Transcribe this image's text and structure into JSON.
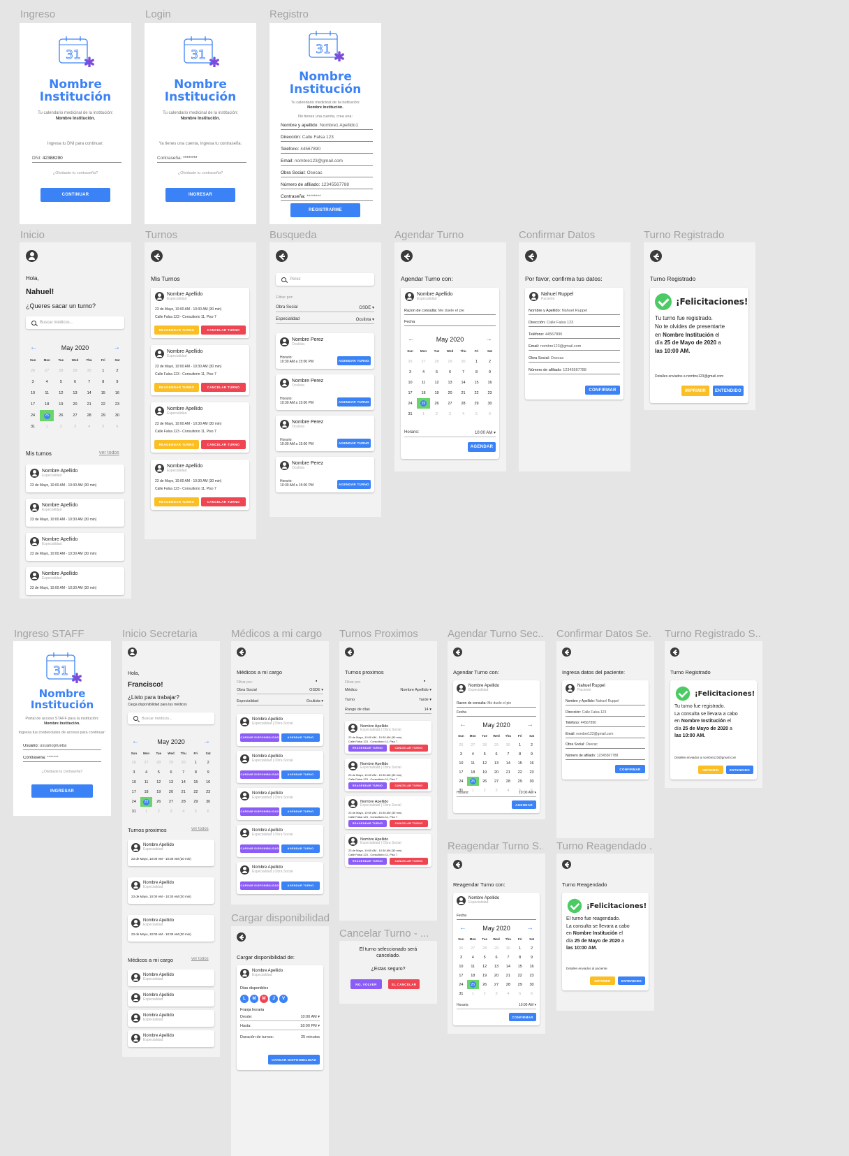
{
  "colors": {
    "accent": "#3b82f6",
    "warning": "#fbbf24",
    "danger": "#ef4452",
    "success": "#4ccb64",
    "purple": "#8b5cf6"
  },
  "logo": {
    "day": "31",
    "inst1": "Nombre",
    "inst2": "Institución"
  },
  "frames": {
    "ingreso": "Ingreso",
    "login": "Login",
    "registro": "Registro",
    "inicio": "Inicio",
    "turnos": "Turnos",
    "busqueda": "Busqueda",
    "agendar": "Agendar Turno",
    "confirmar": "Confirmar Datos",
    "registrado": "Turno Registrado",
    "staff": "Ingreso STAFF",
    "secretaria": "Inicio Secretaria",
    "medicos": "Médicos a mi cargo",
    "proximos": "Turnos Proximos",
    "agendarSec": "Agendar Turno Sec...",
    "confirmarSe": "Confirmar Datos Se...",
    "registradoS": "Turno Registrado S...",
    "cargar": "Cargar disponibilidad",
    "cancelar": "Cancelar Turno - ...",
    "reagendar": "Reagendar Turno S...",
    "reagendado": "Turno Reagendado ..."
  },
  "common": {
    "tag1": "Tu calendario medicinal de la institución:",
    "tagInst": "Nombre Institución.",
    "forgot": "¿Olvidaste tu contraseña?",
    "name": "Nombre Apellido",
    "spec": "Especialidad",
    "specObra": "Especialidad | Obra Social",
    "slot": "23 de Mayo, 10:00 AM - 10:30 AM (30 min)",
    "addr": "Calle Falsa 123 - Consultorio 11, Piso 7",
    "btnCambiar": "Cargar disponibilidad",
    "btnCancelar": "Cancelar turno",
    "btnReagendar": "Reagendar turno",
    "btnAgendar": "Agendar turno",
    "month": "May 2020",
    "seeAll": "ver todos"
  },
  "ingreso": {
    "prompt": "Ingresa tu DNI para continuar:",
    "dniLabel": "DNI:",
    "dni": "42388290",
    "btn": "Continuar"
  },
  "login": {
    "prompt": "Ya tienes una cuenta, ingresa tu contraseña:",
    "passLabel": "Contraseña:",
    "pass": "********",
    "btn": "Ingresar"
  },
  "registro": {
    "prompt": "No tienes una cuenta, crea una:",
    "btn": "Registrarme",
    "fields": [
      [
        "Nombre y apellido:",
        "Nombre1 Apellido1"
      ],
      [
        "Dirección:",
        "Calle Falsa 123"
      ],
      [
        "Teléfono:",
        "44567890"
      ],
      [
        "Email:",
        "nombre123@gmail.com"
      ],
      [
        "Obra Social:",
        "Osecac"
      ],
      [
        "Número de afiliado:",
        "12345567788"
      ],
      [
        "Contraseña:",
        "********"
      ]
    ]
  },
  "inicio": {
    "hola": "Hola,",
    "nombre": "Nahuel!",
    "pregunta": "¿Queres sacar un turno?",
    "search": "Buscar médicos...",
    "mis": "Mis turnos"
  },
  "turnos": {
    "title": "Mis Turnos"
  },
  "busqueda": {
    "search": "Perez",
    "filtrar": "Filtrar por:",
    "obra": "Obra Social",
    "obraVal": "OSDE",
    "esp": "Especialidad",
    "espVal": "Oculista",
    "doc": "Nombre Perez",
    "docSpec": "Oculista",
    "horario": "Horario:",
    "horas": "10:30 AM a 15:00 PM"
  },
  "agendar": {
    "title": "Agendar Turno con:",
    "razonLabel": "Razon de consulta:",
    "razon": "Me duele el pie",
    "fecha": "Fecha",
    "horario": "Horario:",
    "hora": "10:00 AM",
    "btn": "Agendar"
  },
  "confirmar": {
    "title": "Por favor, confirma tus datos:",
    "nombre": "Nahuel Ruppel",
    "rol": "Paciente",
    "btn": "Confirmar",
    "fields": [
      [
        "Nombre y Apellido:",
        "Nahuel Ruppel"
      ],
      [
        "Dirección:",
        "Calle Falsa 123"
      ],
      [
        "Teléfono:",
        "44567890"
      ],
      [
        "Email:",
        "nombre123@gmail.com"
      ],
      [
        "Obra Social:",
        "Osecac"
      ],
      [
        "Número de afiliado:",
        "12345567788"
      ]
    ]
  },
  "registrado": {
    "title": "Turno Registrado",
    "felic": "¡Felicitaciones!",
    "l1": "Tu turno fue registrado.",
    "l2": "No te olvides de presentarte",
    "l3a": "en ",
    "l3b": "Nombre Institución",
    "l3c": " el",
    "l4a": "día ",
    "l4b": "25 de Mayo de 2020",
    "l4c": " a",
    "l5": "las 10:00 AM.",
    "det": "Detalles enviados a nombre123@gmail.com",
    "b1": "Imprimir",
    "b2": "Entendido"
  },
  "staff": {
    "tag": "Portal de acceso STAFF para la institución:",
    "prompt": "Ingresa tus credenciales de acceso para continuar:",
    "userLabel": "Usuario:",
    "user": "usuarioprueba",
    "passLabel": "Contraseña:",
    "pass": "*******",
    "btn": "Ingresar"
  },
  "secretaria": {
    "hola": "Hola,",
    "nombre": "Francisco!",
    "pregunta": "¿Listo para trabajar?",
    "sub": "Carga disponibilidad para tus médicos",
    "search": "Buscar médicos...",
    "prox": "Turnos proximos",
    "med": "Médicos a mi cargo"
  },
  "medicos": {
    "title": "Médicos a mi cargo",
    "filtrar": "Filtrar por:",
    "obra": "Obra Social",
    "obraVal": "OSDE",
    "esp": "Especialidad",
    "espVal": "Oculista"
  },
  "proximos": {
    "title": "Turnos proximos",
    "filtrar": "Filtrar por:",
    "medico": "Médico",
    "medicoVal": "Nombre Apellido",
    "turno": "Turno",
    "turnoVal": "Tarde",
    "rango": "Rango de días",
    "rangoVal": "14"
  },
  "regSec": {
    "line1": "La consulta se llevara a cabo",
    "det": "Detalles enviados a nombre123@gmail.com"
  },
  "confSec": {
    "title": "Ingresa datos del paciente:"
  },
  "cargar": {
    "title": "Cargar disponibilidad de:",
    "dias": "Días disponibles",
    "days": [
      "L",
      "M",
      "M",
      "J",
      "V"
    ],
    "franja": "Franja horaria",
    "desde": "Desde:",
    "desdeVal": "10:00 AM",
    "hasta": "Hasta:",
    "hastaVal": "18:00 PM",
    "dur": "Duración de turnos:",
    "durVal": "25 minutos",
    "btn": "Cargar disponibilidad"
  },
  "cancelar": {
    "msg1": "El turno seleccionado será",
    "msg2": "cancelado.",
    "q": "¿Estas seguro?",
    "no": "No, volver",
    "si": "Si, cancelar"
  },
  "reagendar": {
    "title": "Reagendar Turno con:",
    "btn": "Confirmar"
  },
  "reagendado": {
    "title": "Turno Reagendado",
    "l1": "El turno fue reagendado.",
    "det": "Detalles enviados al paciente."
  }
}
